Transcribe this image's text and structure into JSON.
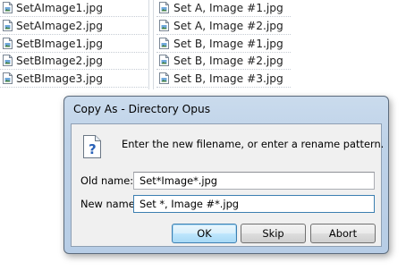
{
  "file_list": {
    "left": [
      "SetAImage1.jpg",
      "SetAImage2.jpg",
      "SetBImage1.jpg",
      "SetBImage2.jpg",
      "SetBImage3.jpg"
    ],
    "right": [
      "Set A, Image #1.jpg",
      "Set A, Image #2.jpg",
      "Set B, Image #1.jpg",
      "Set B, Image #2.jpg",
      "Set B, Image #3.jpg"
    ],
    "icon": "image-file-icon"
  },
  "dialog": {
    "title": "Copy As - Directory Opus",
    "icon": "help-question-icon",
    "prompt": "Enter the new filename,  or enter a rename pattern.",
    "old_name_label": "Old name:",
    "old_name_value": "Set*Image*.jpg",
    "new_name_label": "New name:",
    "new_name_value": "Set *, Image #*.jpg",
    "buttons": {
      "ok": "OK",
      "skip": "Skip",
      "abort": "Abort"
    }
  },
  "colors": {
    "dialog_frame": "#b9cfe7",
    "dialog_body": "#f0f0f0",
    "default_button_border": "#3c7fb1"
  }
}
